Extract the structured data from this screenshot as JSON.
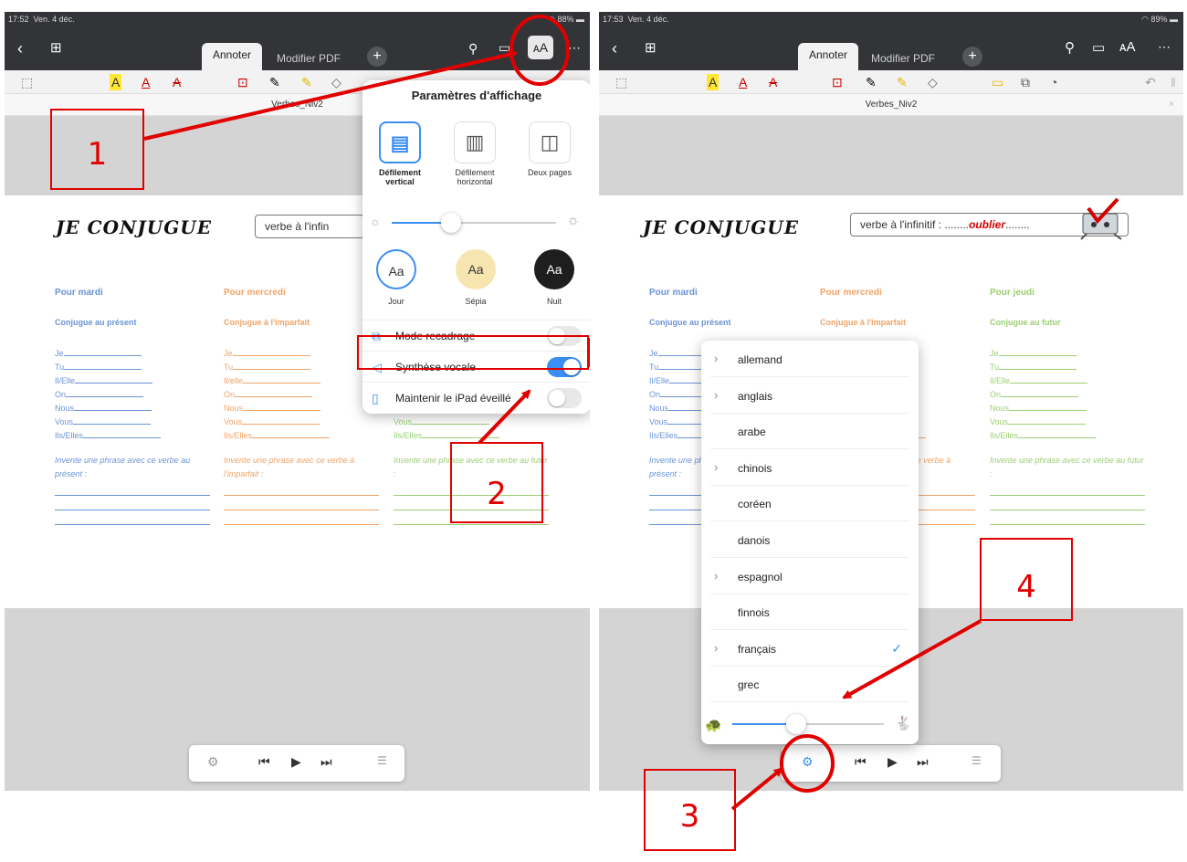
{
  "left": {
    "status": {
      "time": "17:52",
      "date": "Ven. 4 déc.",
      "battery": "88%"
    },
    "tabs": {
      "annotate": "Annoter",
      "edit": "Modifier PDF"
    },
    "doc_title": "Verbes_Niv2",
    "display_settings": {
      "title": "Paramètres d'affichage",
      "modes": [
        {
          "label": "Défilement vertical"
        },
        {
          "label": "Défilement horizontal"
        },
        {
          "label": "Deux pages"
        }
      ],
      "brightness": 0.36,
      "themes": [
        {
          "sample": "Aa",
          "label": "Jour",
          "color": "#ffffff"
        },
        {
          "sample": "Aa",
          "label": "Sépia",
          "color": "#f7e5b0"
        },
        {
          "sample": "Aa",
          "label": "Nuit",
          "color": "#1e1e1e"
        }
      ],
      "options": [
        {
          "label": "Mode recadrage",
          "on": false
        },
        {
          "label": "Synthèse vocale",
          "on": true
        },
        {
          "label": "Maintenir le iPad éveillé",
          "on": false
        }
      ]
    }
  },
  "right": {
    "status": {
      "time": "17:53",
      "date": "Ven. 4 déc.",
      "battery": "89%"
    },
    "tabs": {
      "annotate": "Annoter",
      "edit": "Modifier PDF"
    },
    "doc_title": "Verbes_Niv2",
    "languages": [
      {
        "name": "allemand",
        "has_children": true,
        "selected": false
      },
      {
        "name": "anglais",
        "has_children": true,
        "selected": false
      },
      {
        "name": "arabe",
        "has_children": false,
        "selected": false
      },
      {
        "name": "chinois",
        "has_children": true,
        "selected": false
      },
      {
        "name": "coréen",
        "has_children": false,
        "selected": false
      },
      {
        "name": "danois",
        "has_children": false,
        "selected": false
      },
      {
        "name": "espagnol",
        "has_children": true,
        "selected": false
      },
      {
        "name": "finnois",
        "has_children": false,
        "selected": false
      },
      {
        "name": "français",
        "has_children": true,
        "selected": true
      },
      {
        "name": "grec",
        "has_children": false,
        "selected": false
      }
    ],
    "speech_rate": 0.42
  },
  "worksheet": {
    "title": "JE CONJUGUE",
    "verb_prefix": "verbe à l'infinitif : ........",
    "verb": "oublier",
    "verb_suffix": "........",
    "verb_box_short": "verbe à l'infin",
    "columns": [
      {
        "day": "Pour mardi",
        "tense": "Conjugue au présent",
        "color": "#6b93d6",
        "prompt": "Invente une phrase avec ce verbe au présent :",
        "pronouns": [
          "Je",
          "Tu",
          "Il/Elle",
          "On",
          "Nous",
          "Vous",
          "Ils/Elles"
        ]
      },
      {
        "day": "Pour mercredi",
        "tense": "Conjugue à l'imparfait",
        "color": "#f0a468",
        "prompt": "Invente une phrase avec ce verbe à l'imparfait :",
        "pronouns": [
          "Je",
          "Tu",
          "Il/elle",
          "On",
          "Nous",
          "Vous",
          "Ils/Elles"
        ]
      },
      {
        "day": "Pour jeudi",
        "tense": "Conjugue au futur",
        "color": "#9ccf73",
        "prompt": "Invente une phrase avec ce verbe au futur :",
        "pronouns": [
          "Je",
          "Tu",
          "Il/Elle",
          "On",
          "Nous",
          "Vous",
          "Ils/Elles"
        ]
      }
    ]
  },
  "callouts": [
    "1",
    "2",
    "3",
    "4"
  ],
  "colors": {
    "accent": "#3b8ef3",
    "annotation": "#e00000",
    "toolbar_dark": "#333438"
  }
}
